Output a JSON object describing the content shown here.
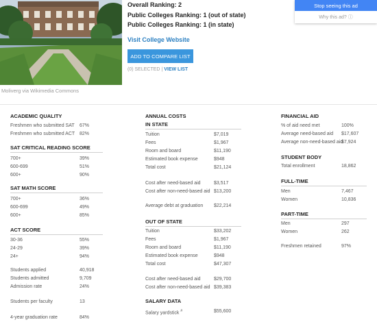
{
  "photo": {
    "credit": "Moliverg via Wikimedia Commons"
  },
  "rankings": {
    "overall": "Overall Ranking: 2",
    "out_of_state": "Public Colleges Ranking: 1 (out of state)",
    "in_state": "Public Colleges Ranking: 1 (in state)"
  },
  "visit_link": "Visit College Website",
  "compare_button": "ADD TO COMPARE LIST",
  "compare": {
    "selected": "(0) SELECTED",
    "separator": "|",
    "view_list": "VIEW LIST"
  },
  "ad": {
    "stop_label": "Stop seeing this ad",
    "why_label": "Why this ad? ⓘ"
  },
  "academic_quality": {
    "title": "ACADEMIC QUALITY",
    "rows": [
      {
        "label": "Freshmen who submitted SAT",
        "value": "67%"
      },
      {
        "label": "Freshmen who submitted ACT",
        "value": "82%"
      }
    ]
  },
  "sat_reading": {
    "title": "SAT CRITICAL READING SCORE",
    "rows": [
      {
        "label": "700+",
        "value": "39%"
      },
      {
        "label": "600-699",
        "value": "51%"
      },
      {
        "label": "600+",
        "value": "90%"
      }
    ]
  },
  "sat_math": {
    "title": "SAT MATH SCORE",
    "rows": [
      {
        "label": "700+",
        "value": "36%"
      },
      {
        "label": "600-699",
        "value": "49%"
      },
      {
        "label": "600+",
        "value": "85%"
      }
    ]
  },
  "act": {
    "title": "ACT SCORE",
    "rows": [
      {
        "label": "30-36",
        "value": "55%"
      },
      {
        "label": "24-29",
        "value": "39%"
      },
      {
        "label": "24+",
        "value": "94%"
      }
    ]
  },
  "admissions": {
    "rows": [
      {
        "label": "Students applied",
        "value": "40,918"
      },
      {
        "label": "Students admitted",
        "value": "9,709"
      },
      {
        "label": "Admission rate",
        "value": "24%"
      }
    ]
  },
  "faculty": {
    "label": "Students per faculty",
    "value": "13"
  },
  "graduation": {
    "label": "4-year graduation rate",
    "value": "84%"
  },
  "annual_costs": {
    "title": "ANNUAL COSTS",
    "in_state": {
      "title": "IN STATE",
      "rows": [
        {
          "label": "Tuition",
          "value": "$7,019"
        },
        {
          "label": "Fees",
          "value": "$1,967"
        },
        {
          "label": "Room and board",
          "value": "$11,190"
        },
        {
          "label": "Estimated book expense",
          "value": "$948"
        },
        {
          "label": "Total cost",
          "value": "$21,124"
        }
      ],
      "after_aid": [
        {
          "label": "Cost after need-based aid",
          "value": "$3,517"
        },
        {
          "label": "Cost after non-need-based aid",
          "value": "$13,200"
        }
      ],
      "debt": {
        "label": "Average debt at graduation",
        "value": "$22,214"
      }
    },
    "out_of_state": {
      "title": "OUT OF STATE",
      "rows": [
        {
          "label": "Tuition",
          "value": "$33,202"
        },
        {
          "label": "Fees",
          "value": "$1,967"
        },
        {
          "label": "Room and board",
          "value": "$11,190"
        },
        {
          "label": "Estimated book expense",
          "value": "$948"
        },
        {
          "label": "Total cost",
          "value": "$47,307"
        }
      ],
      "after_aid": [
        {
          "label": "Cost after need-based aid",
          "value": "$29,700"
        },
        {
          "label": "Cost after non-need-based aid",
          "value": "$39,383"
        }
      ]
    }
  },
  "salary": {
    "title": "SALARY DATA",
    "label": "Salary yardstick",
    "marker": "#",
    "value": "$55,600"
  },
  "financial_aid": {
    "title": "FINANCIAL AID",
    "rows": [
      {
        "label": "% of aid need met",
        "value": "100%"
      },
      {
        "label": "Average need-based aid",
        "value": "$17,607"
      },
      {
        "label": "Average non-need-based aid",
        "value": "$7,924"
      }
    ]
  },
  "student_body": {
    "title": "STUDENT BODY",
    "rows": [
      {
        "label": "Total enrollment",
        "value": "18,862"
      }
    ]
  },
  "full_time": {
    "title": "FULL-TIME",
    "rows": [
      {
        "label": "Men",
        "value": "7,467"
      },
      {
        "label": "Women",
        "value": "10,836"
      }
    ]
  },
  "part_time": {
    "title": "PART-TIME",
    "rows": [
      {
        "label": "Men",
        "value": "297"
      },
      {
        "label": "Women",
        "value": "262"
      }
    ]
  },
  "retention": {
    "label": "Freshmen retained",
    "value": "97%"
  }
}
